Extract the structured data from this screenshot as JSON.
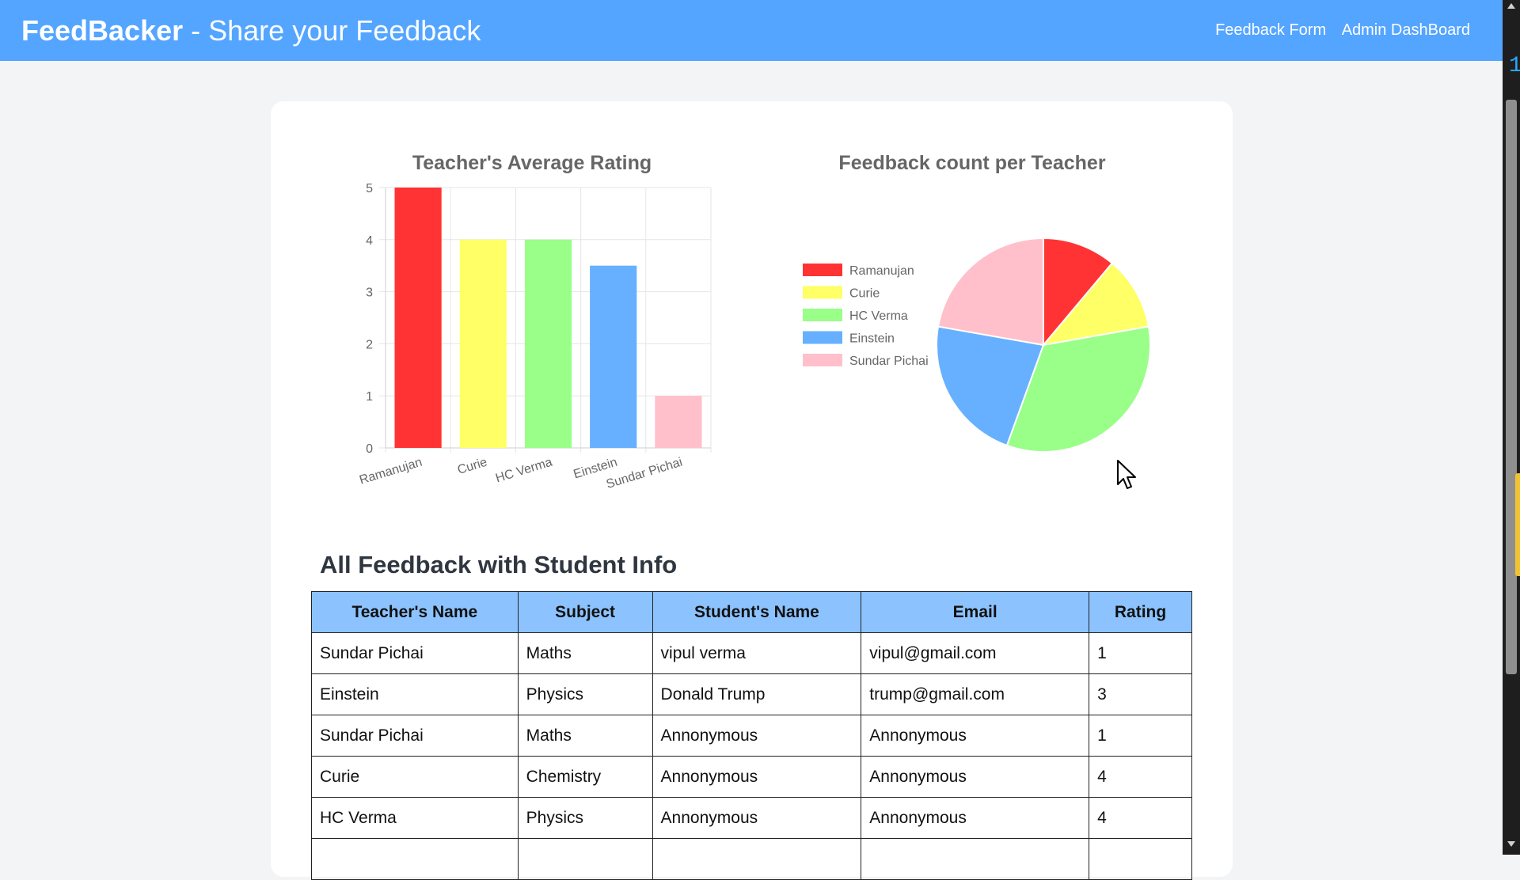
{
  "header": {
    "brand": "FeedBacker",
    "separator": " - ",
    "tagline": "Share your Feedback",
    "nav": [
      "Feedback Form",
      "Admin DashBoard"
    ],
    "bg_color": "#54a5ff"
  },
  "chart_data": [
    {
      "type": "bar",
      "title": "Teacher's Average Rating",
      "categories": [
        "Ramanujan",
        "Curie",
        "HC Verma",
        "Einstein",
        "Sundar Pichai"
      ],
      "values": [
        5,
        4,
        4,
        3.5,
        1
      ],
      "colors": [
        "#ff3333",
        "#ffff66",
        "#99ff88",
        "#66b0ff",
        "#ffc0cb"
      ],
      "yticks": [
        "0",
        "1",
        "2",
        "3",
        "4",
        "5"
      ],
      "ylim": [
        0,
        5
      ],
      "grid": true
    },
    {
      "type": "pie",
      "title": "Feedback count per Teacher",
      "labels": [
        "Ramanujan",
        "Curie",
        "HC Verma",
        "Einstein",
        "Sundar Pichai"
      ],
      "values": [
        1,
        1,
        3,
        2,
        2
      ],
      "colors": [
        "#ff3333",
        "#ffff66",
        "#99ff88",
        "#66b0ff",
        "#ffc0cb"
      ],
      "legend_position": "left"
    }
  ],
  "table": {
    "heading": "All Feedback with Student Info",
    "columns": [
      "Teacher's Name",
      "Subject",
      "Student's Name",
      "Email",
      "Rating"
    ],
    "rows": [
      [
        "Sundar Pichai",
        "Maths",
        "vipul verma",
        "vipul@gmail.com",
        "1"
      ],
      [
        "Einstein",
        "Physics",
        "Donald Trump",
        "trump@gmail.com",
        "3"
      ],
      [
        "Sundar Pichai",
        "Maths",
        "Annonymous",
        "Annonymous",
        "1"
      ],
      [
        "Curie",
        "Chemistry",
        "Annonymous",
        "Annonymous",
        "4"
      ],
      [
        "HC Verma",
        "Physics",
        "Annonymous",
        "Annonymous",
        "4"
      ],
      [
        "",
        "",
        "",
        "",
        ""
      ]
    ]
  },
  "sidebar_edge": {
    "glyph": "1"
  }
}
